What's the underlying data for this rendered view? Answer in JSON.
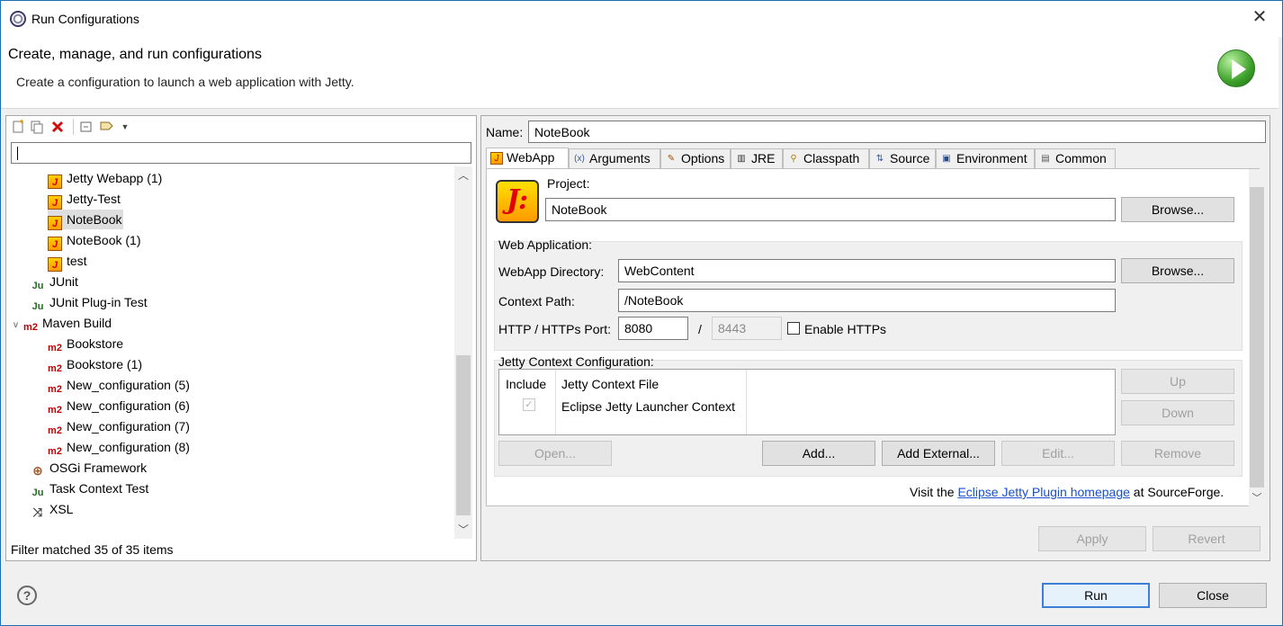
{
  "window": {
    "title": "Run Configurations",
    "close": "✕"
  },
  "banner": {
    "heading": "Create, manage, and run configurations",
    "subtitle": "Create a configuration to launch a web application with Jetty."
  },
  "toolbar": {
    "new": "new-config-icon",
    "duplicate": "duplicate-icon",
    "delete": "delete-icon",
    "collapse": "collapse-all-icon",
    "filter": "filter-icon"
  },
  "filter": {
    "value": ""
  },
  "tree": {
    "items": [
      {
        "label": "Jetty Webapp (1)",
        "icon": "jetty-icon"
      },
      {
        "label": "Jetty-Test",
        "icon": "jetty-icon"
      },
      {
        "label": "NoteBook",
        "icon": "jetty-icon",
        "selected": true
      },
      {
        "label": "NoteBook (1)",
        "icon": "jetty-icon"
      },
      {
        "label": "test",
        "icon": "jetty-icon"
      },
      {
        "label": "JUnit",
        "icon": "junit-icon",
        "icon_text": "Ju"
      },
      {
        "label": "JUnit Plug-in Test",
        "icon": "junit-plugin-icon",
        "icon_text": "Ju"
      },
      {
        "label": "Maven Build",
        "icon": "maven-icon",
        "icon_text": "m2"
      },
      {
        "label": "Bookstore",
        "icon": "maven-icon",
        "icon_text": "m2"
      },
      {
        "label": "Bookstore (1)",
        "icon": "maven-icon",
        "icon_text": "m2"
      },
      {
        "label": "New_configuration (5)",
        "icon": "maven-icon",
        "icon_text": "m2"
      },
      {
        "label": "New_configuration (6)",
        "icon": "maven-icon",
        "icon_text": "m2"
      },
      {
        "label": "New_configuration (7)",
        "icon": "maven-icon",
        "icon_text": "m2"
      },
      {
        "label": "New_configuration (8)",
        "icon": "maven-icon",
        "icon_text": "m2"
      },
      {
        "label": "OSGi Framework",
        "icon": "osgi-icon"
      },
      {
        "label": "Task Context Test",
        "icon": "task-context-icon",
        "icon_text": "Ju"
      },
      {
        "label": "XSL",
        "icon": "xsl-icon"
      }
    ],
    "status": "Filter matched 35 of 35 items"
  },
  "config": {
    "name_label": "Name:",
    "name_value": "NoteBook",
    "tabs": [
      "WebApp",
      "Arguments",
      "Options",
      "JRE",
      "Classpath",
      "Source",
      "Environment",
      "Common"
    ],
    "project_label": "Project:",
    "project_value": "NoteBook",
    "browse": "Browse...",
    "webapp_group": "Web Application:",
    "webapp_dir_label": "WebApp Directory:",
    "webapp_dir_value": "WebContent",
    "context_path_label": "Context Path:",
    "context_path_value": "/NoteBook",
    "port_label": "HTTP / HTTPs Port:",
    "http_port": "8080",
    "slash": "/",
    "https_port": "8443",
    "enable_https": "Enable HTTPs",
    "jetty_ctx_group": "Jetty Context Configuration:",
    "col_include": "Include",
    "col_file": "Jetty Context File",
    "ctx_row": "Eclipse Jetty Launcher Context",
    "check": "✓",
    "up": "Up",
    "down": "Down",
    "open": "Open...",
    "add": "Add...",
    "add_external": "Add External...",
    "edit": "Edit...",
    "remove": "Remove",
    "visit_pre": "Visit the ",
    "visit_link": "Eclipse Jetty Plugin homepage",
    "visit_post": " at SourceForge.",
    "apply": "Apply",
    "revert": "Revert"
  },
  "footer": {
    "help": "?",
    "run": "Run",
    "close": "Close"
  }
}
